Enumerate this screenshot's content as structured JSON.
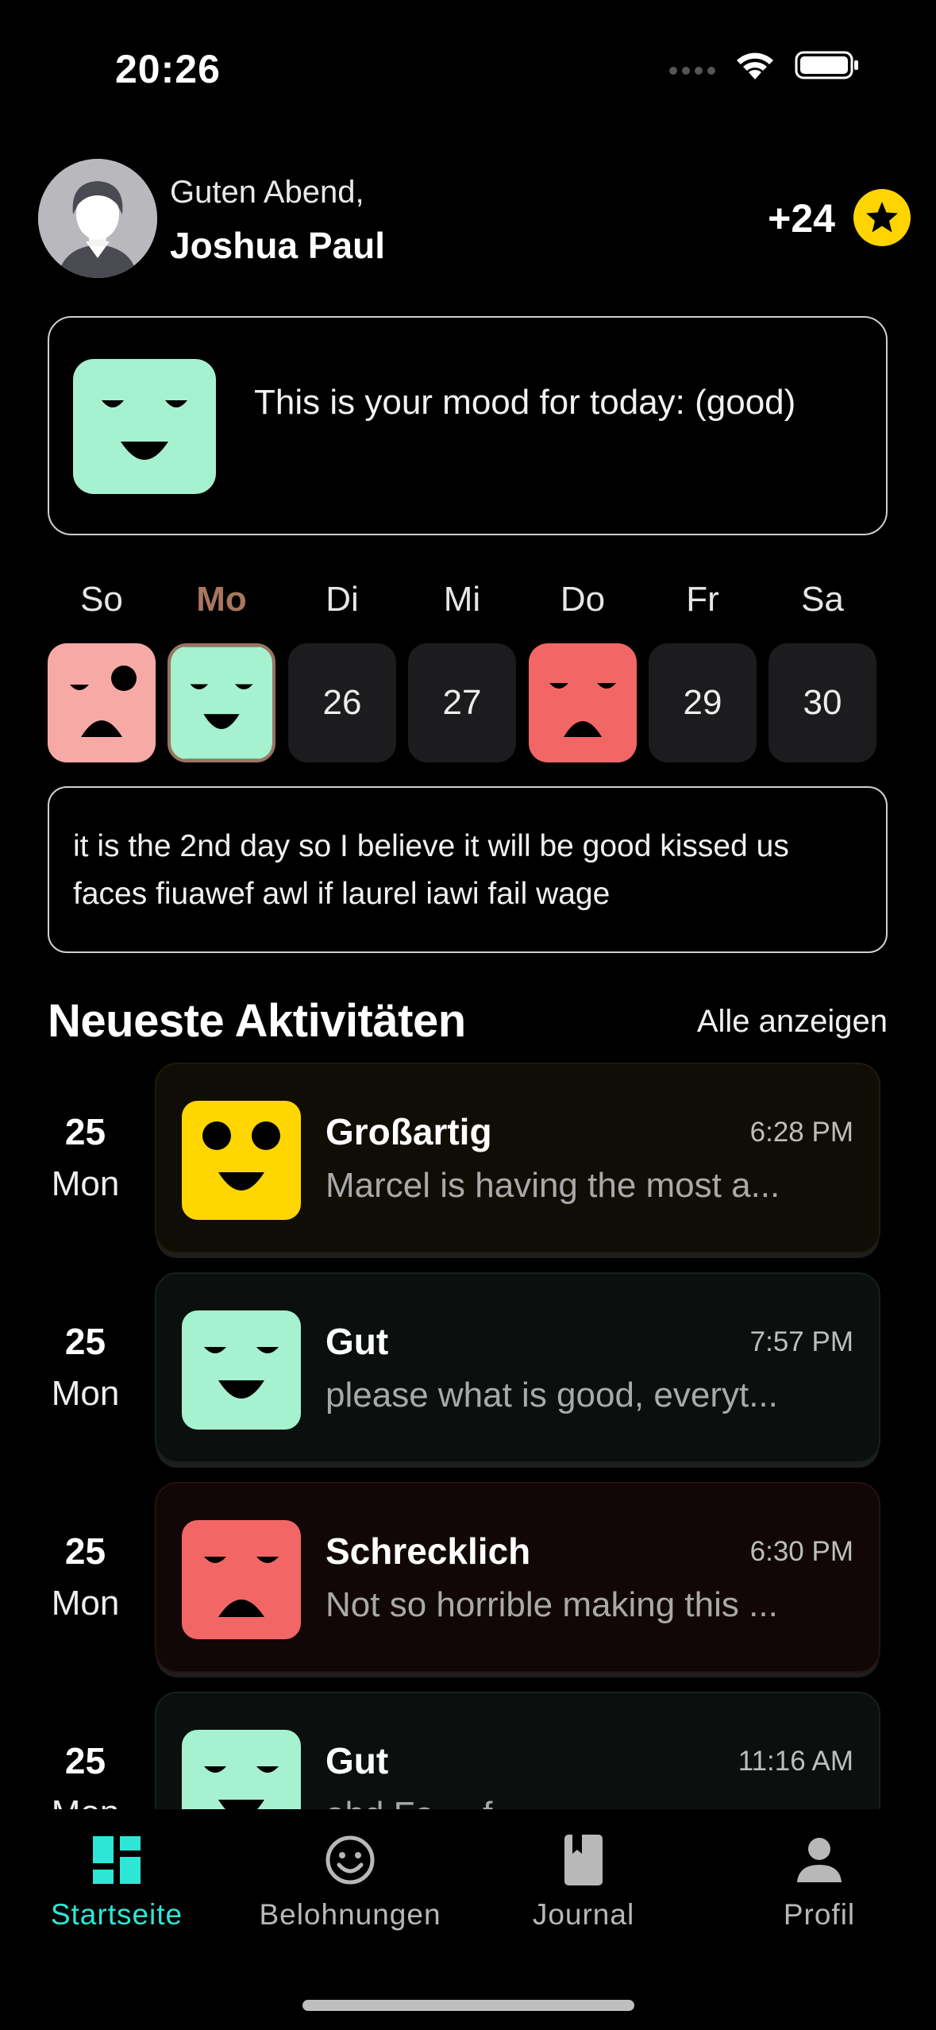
{
  "status_bar": {
    "time": "20:26"
  },
  "header": {
    "greeting": "Guten Abend,",
    "name": "Joshua Paul",
    "points": "+24",
    "points_icon": "star-icon"
  },
  "mood_card": {
    "text": "This is your mood for today: (good)",
    "mood_color": "#a6f1cf"
  },
  "week": {
    "days": [
      {
        "label": "So",
        "type": "face",
        "face": "sad",
        "color": "#f7a9a6"
      },
      {
        "label": "Mo",
        "type": "face",
        "face": "good",
        "color": "#a6f1cf",
        "selected": true
      },
      {
        "label": "Di",
        "type": "number",
        "number": "26"
      },
      {
        "label": "Mi",
        "type": "number",
        "number": "27"
      },
      {
        "label": "Do",
        "type": "face",
        "face": "terrible",
        "color": "#f26666"
      },
      {
        "label": "Fr",
        "type": "number",
        "number": "29"
      },
      {
        "label": "Sa",
        "type": "number",
        "number": "30"
      }
    ]
  },
  "note": {
    "text": "it is the 2nd day so I believe it will be good kissed us faces fiuawef awl if laurel iawi fail wage"
  },
  "activities": {
    "title": "Neueste Aktivitäten",
    "see_all": "Alle anzeigen",
    "items": [
      {
        "day": "25",
        "month": "Mon",
        "label": "Großartig",
        "time": "6:28 PM",
        "desc": "Marcel is having the most a...",
        "face": "great",
        "color": "#ffd600",
        "card_bg": "#0f0d05"
      },
      {
        "day": "25",
        "month": "Mon",
        "label": "Gut",
        "time": "7:57 PM",
        "desc": "please what is good, everyt...",
        "face": "good",
        "color": "#a6f1cf",
        "card_bg": "#0b0f0e"
      },
      {
        "day": "25",
        "month": "Mon",
        "label": "Schrecklich",
        "time": "6:30 PM",
        "desc": "Not so horrible making this ...",
        "face": "terrible",
        "color": "#f26666",
        "card_bg": "#120707"
      },
      {
        "day": "25",
        "month": "Mon",
        "label": "Gut",
        "time": "11:16 AM",
        "desc": "ahd Fa.... f...",
        "face": "good",
        "color": "#a6f1cf",
        "card_bg": "#0b0f0e"
      }
    ]
  },
  "tabs": [
    {
      "label": "Startseite",
      "icon": "dashboard-icon",
      "active": true
    },
    {
      "label": "Belohnungen",
      "icon": "smiley-icon",
      "active": false
    },
    {
      "label": "Journal",
      "icon": "book-icon",
      "active": false
    },
    {
      "label": "Profil",
      "icon": "person-icon",
      "active": false
    }
  ],
  "colors": {
    "accent": "#2ee6d6",
    "star": "#ffd400",
    "selected_day": "#a8775f"
  }
}
